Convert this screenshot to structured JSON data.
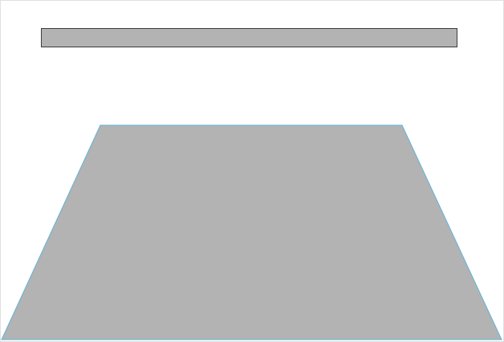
{
  "shapes": {
    "bar": {
      "fill": "#b3b3b3",
      "stroke": "#3c3c3c"
    },
    "trapezoid": {
      "fill": "#b3b3b3",
      "stroke": "#5fb3d9"
    }
  }
}
